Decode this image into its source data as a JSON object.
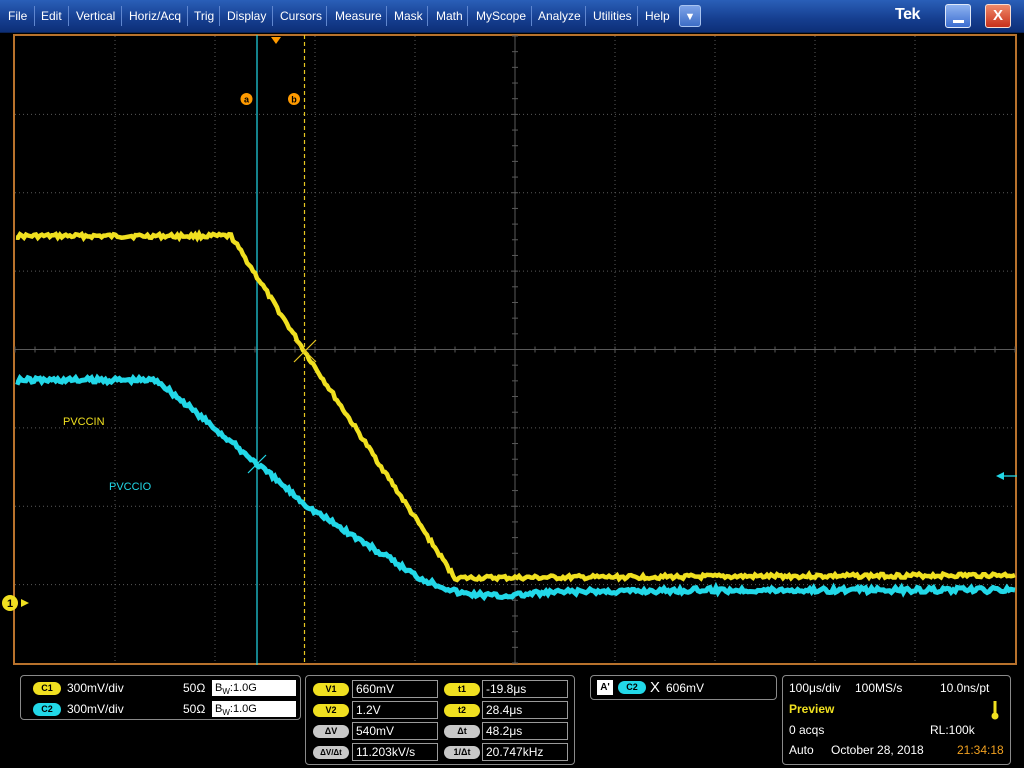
{
  "menu": [
    "File",
    "Edit",
    "Vertical",
    "Horiz/Acq",
    "Trig",
    "Display",
    "Cursors",
    "Measure",
    "Mask",
    "Math",
    "MyScope",
    "Analyze",
    "Utilities",
    "Help"
  ],
  "dropdown_glyph": "▼",
  "brand": "Tek",
  "close_glyph": "X",
  "cursor_labels": {
    "a": "a",
    "b": "b"
  },
  "channel_marker": "1",
  "trace_labels": {
    "c1": "PVCCIN",
    "c2": "PVCCIO"
  },
  "colors": {
    "ch1": "#f0e020",
    "ch2": "#22d8e8",
    "frame": "#b8722c",
    "grid": "#5a5a5a"
  },
  "channels": [
    {
      "badge": "C1",
      "scale": "300mV/div",
      "impedance": "50Ω",
      "bw_prefix": "B",
      "bw_sub": "W",
      "bw_value": ":1.0G"
    },
    {
      "badge": "C2",
      "scale": "300mV/div",
      "impedance": "50Ω",
      "bw_prefix": "B",
      "bw_sub": "W",
      "bw_value": ":1.0G"
    }
  ],
  "cursor_readout": {
    "rows": [
      {
        "vlabel": "V1",
        "vvalue": "660mV",
        "tlabel": "t1",
        "tvalue": "-19.8μs"
      },
      {
        "vlabel": "V2",
        "vvalue": "1.2V",
        "tlabel": "t2",
        "tvalue": "28.4μs"
      },
      {
        "vlabel": "ΔV",
        "vvalue": "540mV",
        "tlabel": "Δt",
        "tvalue": "48.2μs"
      },
      {
        "vlabel": "ΔV/Δt",
        "vvalue": "11.203kV/s",
        "tlabel": "1/Δt",
        "tvalue": "20.747kHz"
      }
    ]
  },
  "trigger": {
    "mode_badge": "A'",
    "source": "C2",
    "slope_glyph": "X",
    "level": "606mV"
  },
  "acquisition": {
    "timebase": "100μs/div",
    "sample_rate": "100MS/s",
    "resolution": "10.0ns/pt",
    "state": "Preview",
    "acqs": "0 acqs",
    "record_length": "RL:100k",
    "trigger_mode": "Auto",
    "date": "October 28, 2018",
    "time": "21:34:18"
  }
}
